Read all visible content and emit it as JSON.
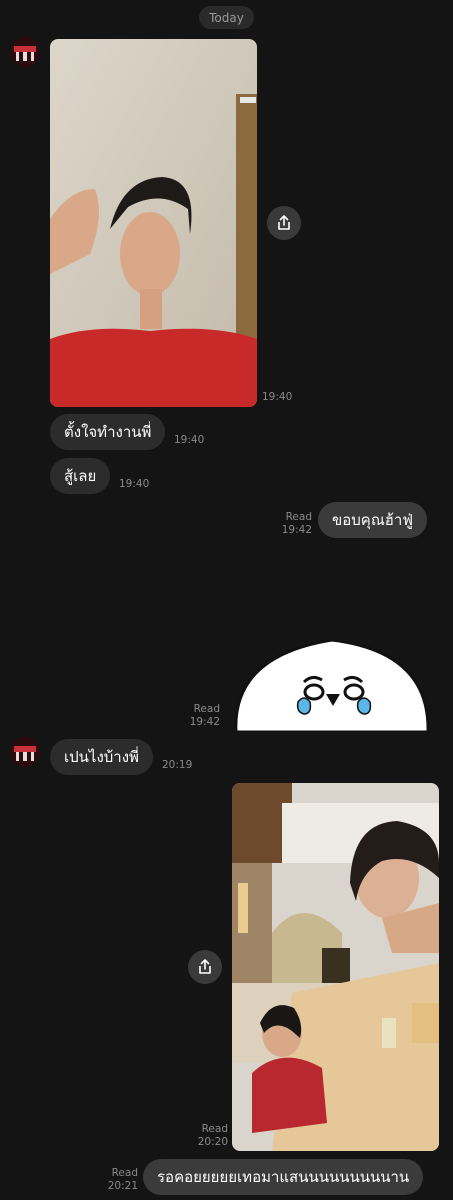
{
  "date_divider": "Today",
  "messages": {
    "m1": {
      "time": "19:40"
    },
    "m2": {
      "text": "ตั้งใจทำงานพี่",
      "time": "19:40"
    },
    "m3": {
      "text": "สู้เลย",
      "time": "19:40"
    },
    "m4": {
      "text": "ขอบคุณฮ้าฟู่",
      "read": "Read",
      "time": "19:42"
    },
    "m5": {
      "read": "Read",
      "time": "19:42"
    },
    "m6": {
      "text": "เปนไงบ้างพี่",
      "time": "20:19"
    },
    "m7": {
      "read": "Read",
      "time": "20:20"
    },
    "m8": {
      "text": "รอคอยยยยยเทอมาแสนนนนนนนนนาน",
      "read": "Read",
      "time": "20:21"
    }
  },
  "icons": {
    "share": "share-icon",
    "sticker": "crying-face-sticker"
  },
  "colors": {
    "background": "#141414",
    "bubble_incoming": "#2c2c2c",
    "bubble_outgoing": "#3b3b3b",
    "meta_text": "#8a8a8a"
  }
}
